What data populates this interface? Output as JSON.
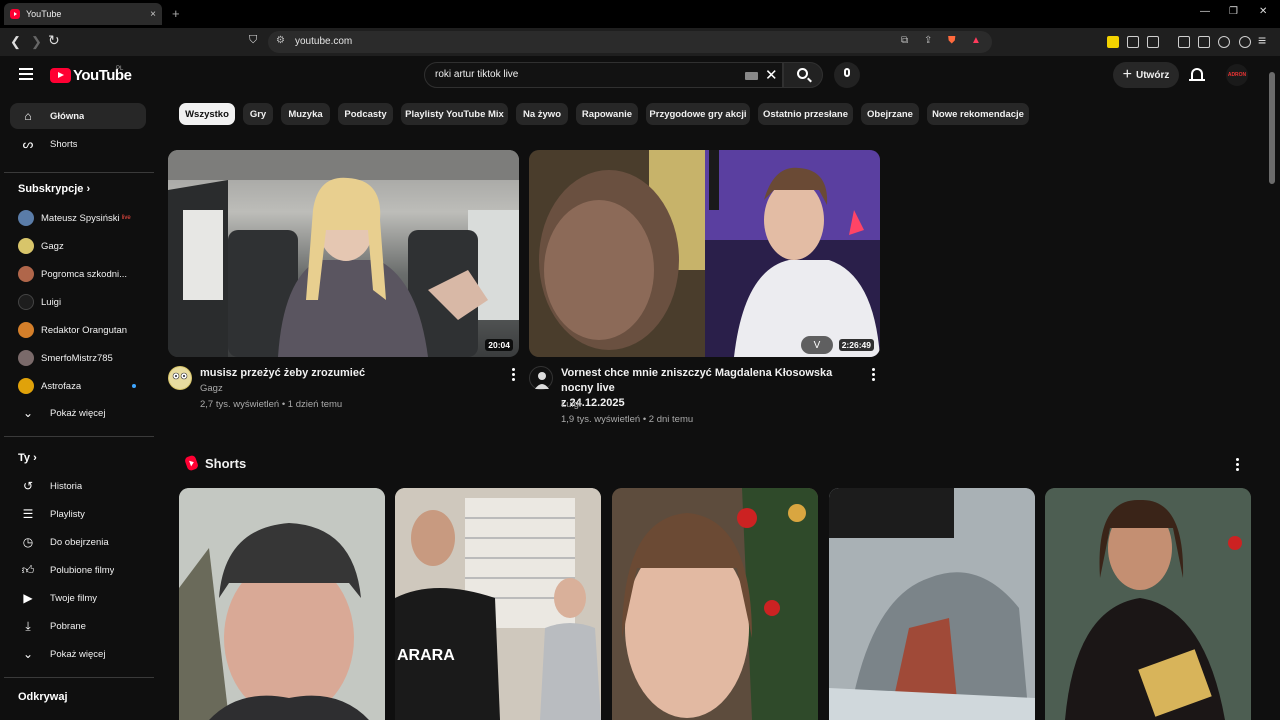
{
  "browser": {
    "tab_title": "YouTube",
    "tab_close": "×",
    "new_tab": "+",
    "url": "youtube.com",
    "min": "—",
    "restore": "❐",
    "close": "✕"
  },
  "header": {
    "logo": "YouTube",
    "country": "PL",
    "search_query": "roki artur tiktok live",
    "create_label": "Utwórz",
    "avatar_text": "ADRON"
  },
  "sidebar": {
    "main": [
      {
        "label": "Główna",
        "icon": "home-icon"
      },
      {
        "label": "Shorts",
        "icon": "shorts-icon"
      }
    ],
    "subscriptions_header": "Subskrypcje",
    "subscriptions": [
      {
        "label": "Mateusz Spysiński",
        "live": "live",
        "color": "#5a7ca8"
      },
      {
        "label": "Gagz",
        "color": "#d8c56a"
      },
      {
        "label": "Pogromca szkodni...",
        "color": "#b0664a"
      },
      {
        "label": "Luigi",
        "color": "#1d1d1d"
      },
      {
        "label": "Redaktor Orangutan",
        "color": "#d47f2a"
      },
      {
        "label": "SmerfoMistrz785",
        "color": "#7a6a6a"
      },
      {
        "label": "Astrofaza",
        "color": "#e0a20a"
      }
    ],
    "show_more_1": "Pokaż więcej",
    "you_header": "Ty",
    "you_items": [
      {
        "label": "Historia",
        "icon": "history-icon"
      },
      {
        "label": "Playlisty",
        "icon": "playlist-icon"
      },
      {
        "label": "Do obejrzenia",
        "icon": "clock-icon"
      },
      {
        "label": "Polubione filmy",
        "icon": "thumb-up-icon"
      },
      {
        "label": "Twoje filmy",
        "icon": "video-icon"
      },
      {
        "label": "Pobrane",
        "icon": "download-icon"
      }
    ],
    "show_more_2": "Pokaż więcej",
    "explore_header": "Odkrywaj"
  },
  "chips": [
    "Wszystko",
    "Gry",
    "Muzyka",
    "Podcasty",
    "Playlisty YouTube Mix",
    "Na żywo",
    "Rapowanie",
    "Przygodowe gry akcji",
    "Ostatnio przesłane",
    "Obejrzane",
    "Nowe rekomendacje"
  ],
  "videos": [
    {
      "title": "musisz przeżyć żeby zrozumieć",
      "channel": "Gagz",
      "meta": "2,7 tys. wyświetleń • 1 dzień temu",
      "duration": "20:04"
    },
    {
      "title_line1": "Vornest chce mnie zniszczyć Magdalena Kłosowska nocny live",
      "title_line2": "z 24.12.2025",
      "channel": "Luigi",
      "meta": "1,9 tys. wyświetleń • 2 dni temu",
      "duration": "2:26:49",
      "overlay_text": "V"
    }
  ],
  "shorts": {
    "title": "Shorts",
    "overlay_text": "ARARA"
  },
  "colors": {
    "accent": "#ff0033",
    "background": "#0f0f0f",
    "chip": "#272727"
  }
}
